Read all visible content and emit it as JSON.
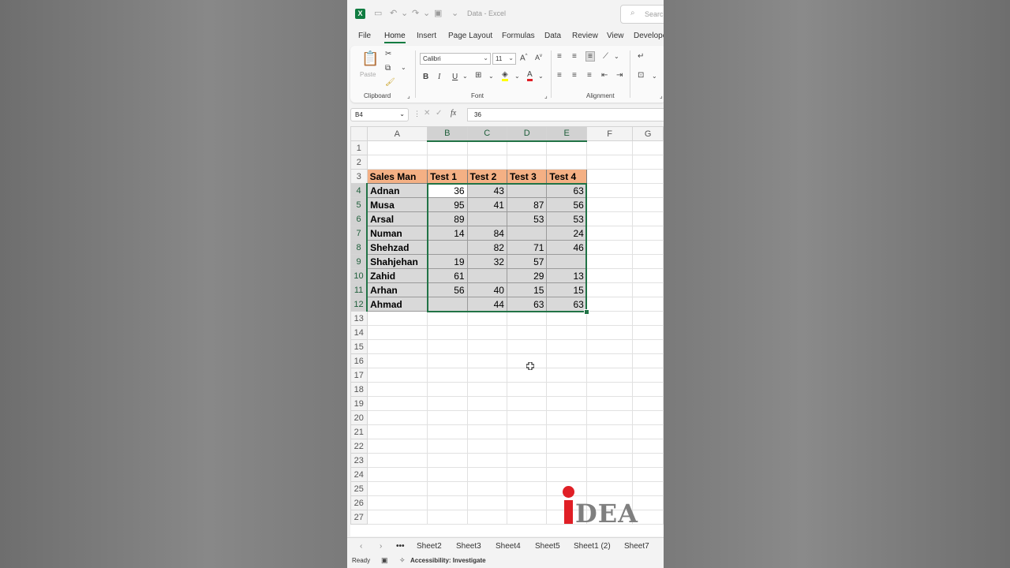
{
  "app": {
    "title": "Data - Excel",
    "search_placeholder": "Search"
  },
  "tabs": [
    "File",
    "Home",
    "Insert",
    "Page Layout",
    "Formulas",
    "Data",
    "Review",
    "View",
    "Develope"
  ],
  "ribbon": {
    "clipboard": {
      "label": "Clipboard",
      "paste": "Paste"
    },
    "font": {
      "label": "Font",
      "name": "Calibri",
      "size": "11",
      "bold": "B",
      "italic": "I",
      "underline": "U"
    },
    "alignment": {
      "label": "Alignment"
    }
  },
  "formula_bar": {
    "name_box": "B4",
    "formula": "36",
    "fx": "fx"
  },
  "grid": {
    "columns": [
      "A",
      "B",
      "C",
      "D",
      "E",
      "F",
      "G"
    ],
    "rows": [
      "1",
      "2",
      "3",
      "4",
      "5",
      "6",
      "7",
      "8",
      "9",
      "10",
      "11",
      "12",
      "13",
      "14",
      "15",
      "16",
      "17",
      "18",
      "19",
      "20",
      "21",
      "22",
      "23",
      "24",
      "25",
      "26",
      "27"
    ],
    "headers": [
      "Sales Man",
      "Test 1",
      "Test 2",
      "Test 3",
      "Test 4"
    ],
    "data": [
      [
        "Adnan",
        "36",
        "43",
        "",
        "63"
      ],
      [
        "Musa",
        "95",
        "41",
        "87",
        "56"
      ],
      [
        "Arsal",
        "89",
        "",
        "53",
        "53"
      ],
      [
        "Numan",
        "14",
        "84",
        "",
        "24"
      ],
      [
        "Shehzad",
        "",
        "82",
        "71",
        "46"
      ],
      [
        "Shahjehan",
        "19",
        "32",
        "57",
        ""
      ],
      [
        "Zahid",
        "61",
        "",
        "29",
        "13"
      ],
      [
        "Arhan",
        "56",
        "40",
        "15",
        "15"
      ],
      [
        "Ahmad",
        "",
        "44",
        "63",
        "63"
      ]
    ]
  },
  "sheets": [
    "Sheet2",
    "Sheet3",
    "Sheet4",
    "Sheet5",
    "Sheet1 (2)",
    "Sheet7"
  ],
  "status": {
    "ready": "Ready",
    "accessibility": "Accessibility: Investigate"
  },
  "logo": {
    "text": "DEA"
  },
  "colors": {
    "excel_green": "#107c41",
    "header_fill": "#f4b084",
    "selection_fill": "#d9d9d9",
    "logo_red": "#e01f26"
  }
}
